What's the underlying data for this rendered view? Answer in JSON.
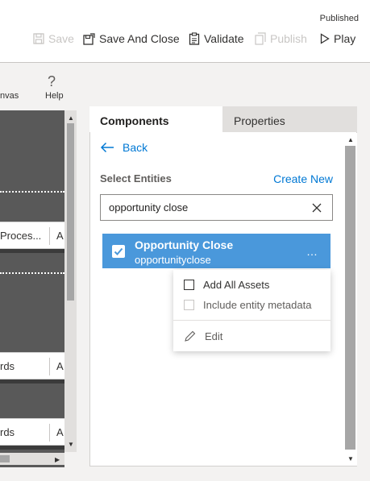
{
  "header": {
    "status": "Published",
    "commands": {
      "save": "Save",
      "save_and_close": "Save And Close",
      "validate": "Validate",
      "publish": "Publish",
      "play": "Play"
    }
  },
  "ribbon": {
    "canvas_label": "nvas",
    "help_label": "Help"
  },
  "canvas": {
    "nodes": [
      {
        "label": "Proces...",
        "suffix": "A"
      },
      {
        "label": "rds",
        "suffix": "A"
      },
      {
        "label": "rds",
        "suffix": "A"
      }
    ]
  },
  "panel": {
    "tabs": {
      "components": "Components",
      "properties": "Properties"
    },
    "back": "Back",
    "select_entities": "Select Entities",
    "create_new": "Create New",
    "search": {
      "value": "opportunity close"
    },
    "entity": {
      "display_name": "Opportunity Close",
      "logical_name": "opportunityclose",
      "more": "…"
    },
    "menu": {
      "add_all_assets": "Add All Assets",
      "include_metadata": "Include entity metadata",
      "edit": "Edit"
    }
  },
  "colors": {
    "accent": "#0078d4",
    "selected_item": "#4a98db",
    "canvas": "#595959"
  }
}
